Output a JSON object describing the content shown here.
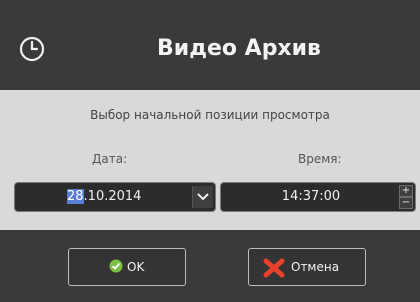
{
  "header": {
    "title": "Видео Архив",
    "icon": "clock-icon"
  },
  "body": {
    "subtitle": "Выбор начальной позиции просмотра",
    "date_label": "Дата:",
    "time_label": "Время:",
    "date_selected": "28",
    "date_rest": ".10.2014",
    "time_value": "14:37:00",
    "spin_up": "+",
    "spin_down": "−"
  },
  "footer": {
    "ok_label": "OK",
    "cancel_label": "Отмена"
  },
  "colors": {
    "header_bg": "#3a3a3a",
    "body_bg": "#d9d9d9",
    "selection": "#5b7fd6",
    "ok_icon": "#7ac143",
    "cancel_icon": "#e8412c"
  }
}
